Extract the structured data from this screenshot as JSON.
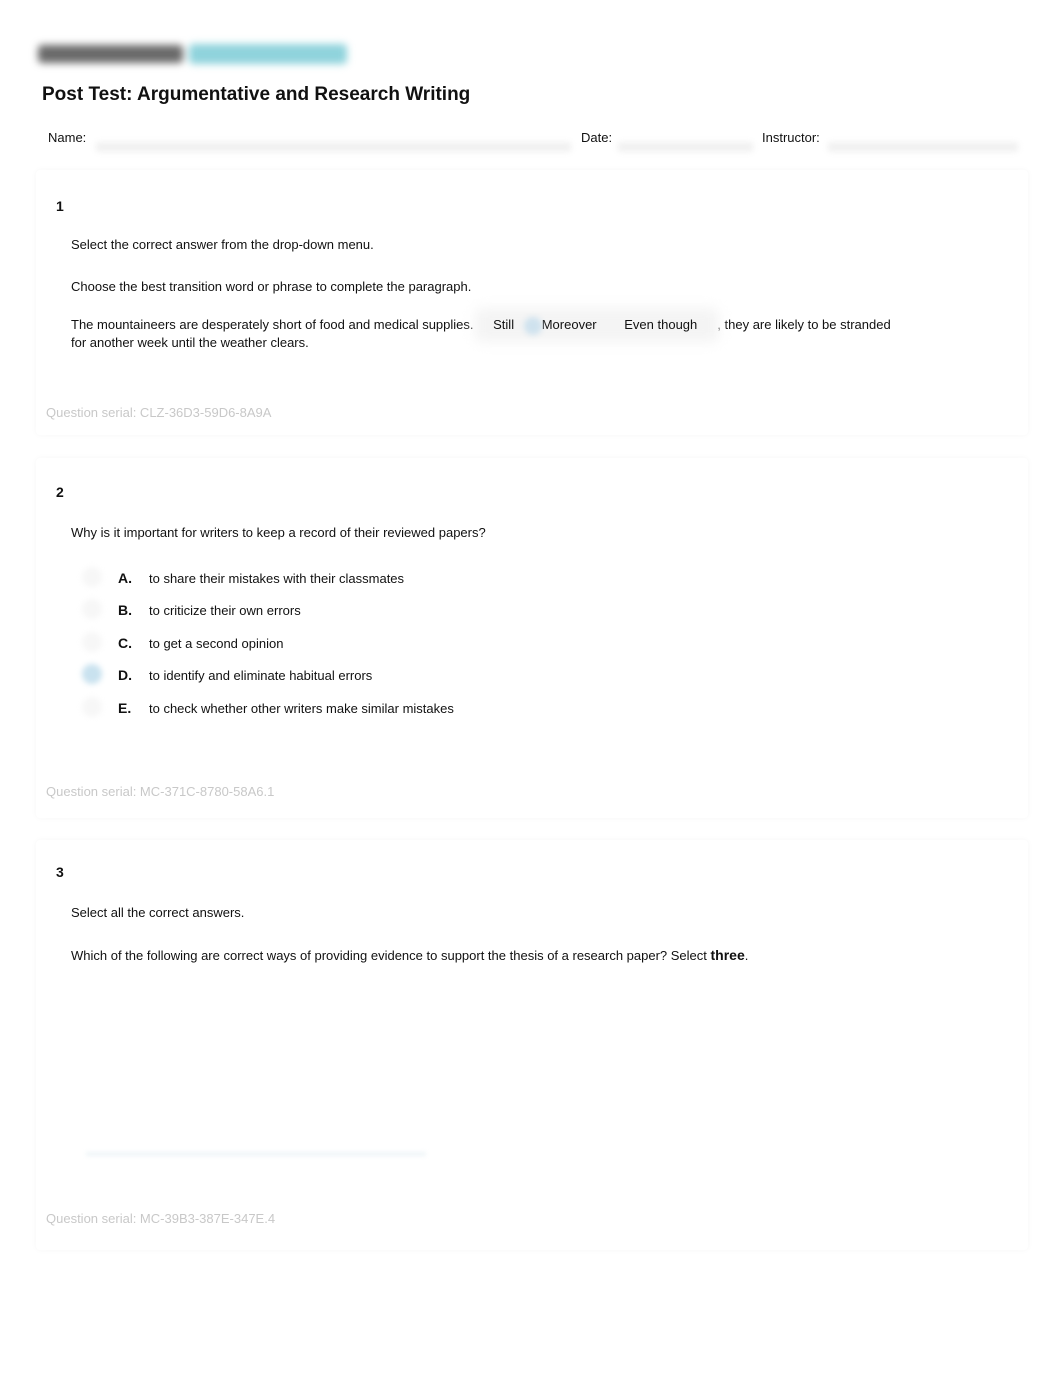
{
  "header": {
    "title": "Post Test: Argumentative and Research Writing",
    "logo_colors": {
      "primary": "#6a6a6a",
      "accent": "#8fd3dc"
    }
  },
  "meta": {
    "name_label": "Name:",
    "date_label": "Date:",
    "instructor_label": "Instructor:"
  },
  "questions": [
    {
      "number": "1",
      "instruction": "Select the correct answer from the drop-down menu.",
      "prompt": "Choose the best transition word or phrase to complete the paragraph.",
      "sentence_before": "The mountaineers are desperately short of food and medical supplies.",
      "dropdown_options": [
        "Still",
        "Moreover",
        "Even though"
      ],
      "sentence_after": ", they are likely to be stranded",
      "sentence_continued": "for another week until the weather clears.",
      "serial": "Question serial: CLZ-36D3-59D6-8A9A"
    },
    {
      "number": "2",
      "prompt": "Why is it important for writers to keep a record of their reviewed papers?",
      "options": [
        {
          "letter": "A.",
          "text": "to share their mistakes with their classmates",
          "selected": false
        },
        {
          "letter": "B.",
          "text": "to criticize their own errors",
          "selected": false
        },
        {
          "letter": "C.",
          "text": "to get a second opinion",
          "selected": false
        },
        {
          "letter": "D.",
          "text": "to identify and eliminate habitual errors",
          "selected": true
        },
        {
          "letter": "E.",
          "text": "to check whether other writers make similar mistakes",
          "selected": false
        }
      ],
      "serial": "Question serial: MC-371C-8780-58A6.1"
    },
    {
      "number": "3",
      "instruction": "Select all the correct answers.",
      "prompt_main": "Which of the following are correct ways of providing evidence to support the thesis of a research paper? Select ",
      "prompt_emphasis": "three",
      "prompt_end": ".",
      "serial": "Question serial: MC-39B3-387E-347E.4"
    }
  ]
}
